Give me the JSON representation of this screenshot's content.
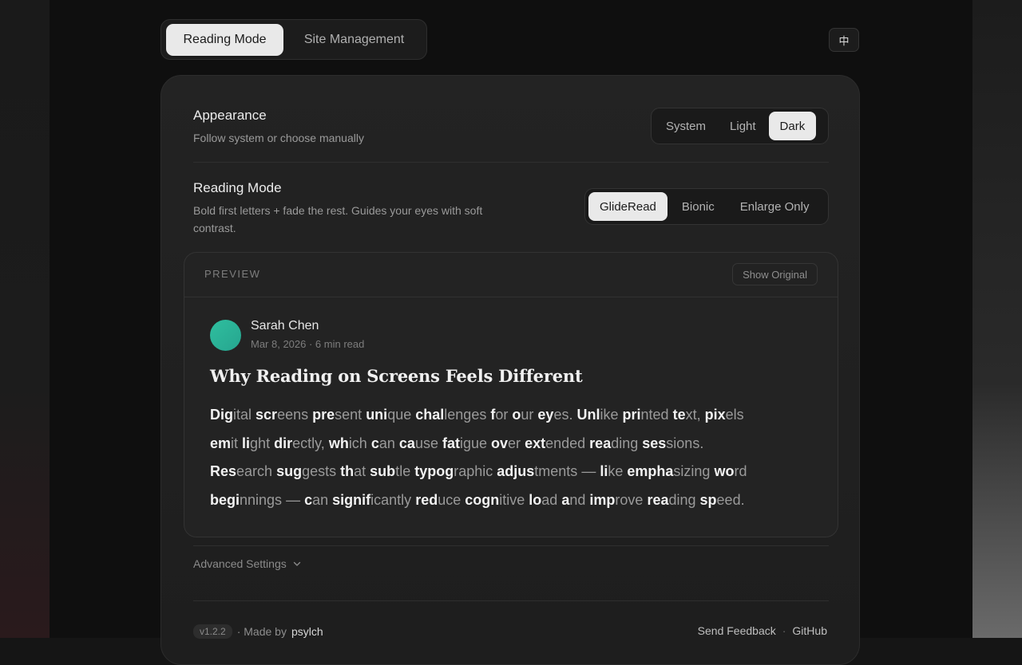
{
  "tabs": [
    {
      "label": "Reading Mode",
      "active": true
    },
    {
      "label": "Site Management",
      "active": false
    }
  ],
  "lang_button": "中",
  "appearance": {
    "title": "Appearance",
    "description": "Follow system or choose manually",
    "options": [
      "System",
      "Light",
      "Dark"
    ],
    "selected": "Dark"
  },
  "reading_mode": {
    "title": "Reading Mode",
    "description_line1": "Bold first letters + fade the rest. Guides your eyes with soft",
    "description_line2": "contrast.",
    "options": [
      "GlideRead",
      "Bionic",
      "Enlarge Only"
    ],
    "selected": "GlideRead"
  },
  "preview": {
    "label": "PREVIEW",
    "show_original": "Show Original",
    "author": "Sarah Chen",
    "meta": "Mar 8, 2026 · 6 min read",
    "title": "Why Reading on Screens Feels Different",
    "body_lines": [
      [
        [
          "Dig",
          "ital"
        ],
        [
          "scr",
          "eens"
        ],
        [
          "pre",
          "sent"
        ],
        [
          "uni",
          "que"
        ],
        [
          "chal",
          "lenges"
        ],
        [
          "f",
          "or"
        ],
        [
          "o",
          "ur"
        ],
        [
          "ey",
          "es."
        ],
        [
          "Unl",
          "ike"
        ],
        [
          "pri",
          "nted"
        ],
        [
          "te",
          "xt,"
        ],
        [
          "pix",
          "els"
        ]
      ],
      [
        [
          "em",
          "it"
        ],
        [
          "li",
          "ght"
        ],
        [
          "dir",
          "ectly,"
        ],
        [
          "wh",
          "ich"
        ],
        [
          "c",
          "an"
        ],
        [
          "ca",
          "use"
        ],
        [
          "fat",
          "igue"
        ],
        [
          "ov",
          "er"
        ],
        [
          "ext",
          "ended"
        ],
        [
          "rea",
          "ding"
        ],
        [
          "ses",
          "sions."
        ]
      ],
      [
        [
          "Res",
          "earch"
        ],
        [
          "sug",
          "gests"
        ],
        [
          "th",
          "at"
        ],
        [
          "sub",
          "tle"
        ],
        [
          "typog",
          "raphic"
        ],
        [
          "adjus",
          "tments"
        ],
        [
          "",
          "—"
        ],
        [
          "li",
          "ke"
        ],
        [
          "empha",
          "sizing"
        ],
        [
          "wo",
          "rd"
        ]
      ],
      [
        [
          "begi",
          "nnings"
        ],
        [
          "",
          "—"
        ],
        [
          "c",
          "an"
        ],
        [
          "signif",
          "icantly"
        ],
        [
          "red",
          "uce"
        ],
        [
          "cogn",
          "itive"
        ],
        [
          "lo",
          "ad"
        ],
        [
          "a",
          "nd"
        ],
        [
          "imp",
          "rove"
        ],
        [
          "rea",
          "ding"
        ],
        [
          "sp",
          "eed."
        ]
      ]
    ]
  },
  "advanced_settings": "Advanced Settings",
  "footer": {
    "version": "v1.2.2",
    "made_by_prefix": "· Made by",
    "made_by_name": "psylch",
    "send_feedback": "Send Feedback",
    "separator": "·",
    "github": "GitHub"
  }
}
